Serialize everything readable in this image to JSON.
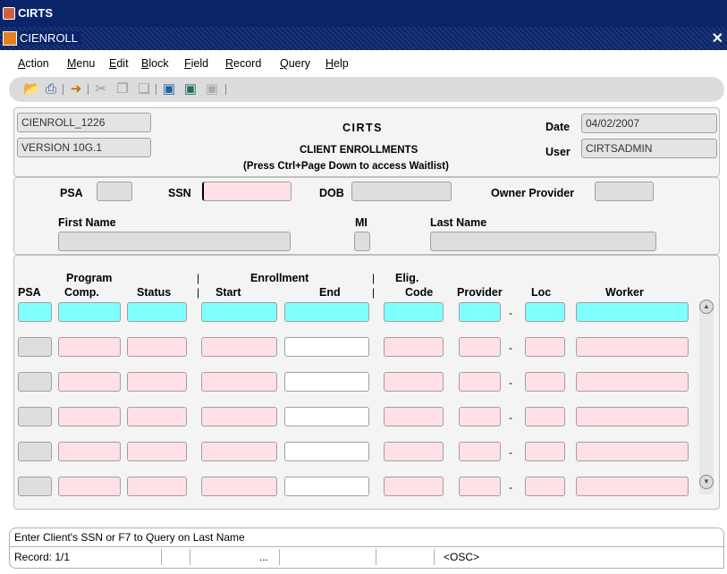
{
  "app": {
    "title": "CIRTS"
  },
  "window": {
    "title": "CIENROLL",
    "close": "✕"
  },
  "menu": [
    "Action",
    "Menu",
    "Edit",
    "Block",
    "Field",
    "Record",
    "Query",
    "Help"
  ],
  "toolbar": {
    "icons": [
      "open-folder-icon",
      "print-icon",
      "exit-icon",
      "cut-icon",
      "copy-icon",
      "paste-icon",
      "query-icon",
      "enter-query-icon",
      "execute-query-icon"
    ]
  },
  "header": {
    "form_id": "CIENROLL_1226",
    "version": "VERSION 10G.1",
    "title": "CIRTS",
    "subtitle": "CLIENT ENROLLMENTS",
    "note": "(Press Ctrl+Page Down to access Waitlist)",
    "date_label": "Date",
    "date_value": "04/02/2007",
    "user_label": "User",
    "user_value": "CIRTSADMIN"
  },
  "search": {
    "psa_label": "PSA",
    "ssn_label": "SSN",
    "dob_label": "DOB",
    "owner_label": "Owner Provider",
    "first_name_label": "First Name",
    "mi_label": "MI",
    "last_name_label": "Last Name"
  },
  "grid": {
    "headers": {
      "psa": "PSA",
      "program_top": "Program",
      "program_bottom": "Comp.",
      "status": "Status",
      "enrollment": "Enrollment",
      "start": "Start",
      "end": "End",
      "elig_top": "Elig.",
      "elig_bottom": "Code",
      "provider": "Provider",
      "loc": "Loc",
      "worker": "Worker"
    },
    "separator": "|",
    "dash": "-",
    "row_count": 6
  },
  "status": {
    "hint": "Enter Client's SSN or F7 to Query on Last Name",
    "record": "Record: 1/1",
    "ellipsis": "...",
    "mode": "<OSC>"
  },
  "colors": {
    "title_bar": "#0a246a",
    "active_field": "#80ffff",
    "pending_field": "#ffe0e6",
    "readonly_field": "#dedede"
  }
}
